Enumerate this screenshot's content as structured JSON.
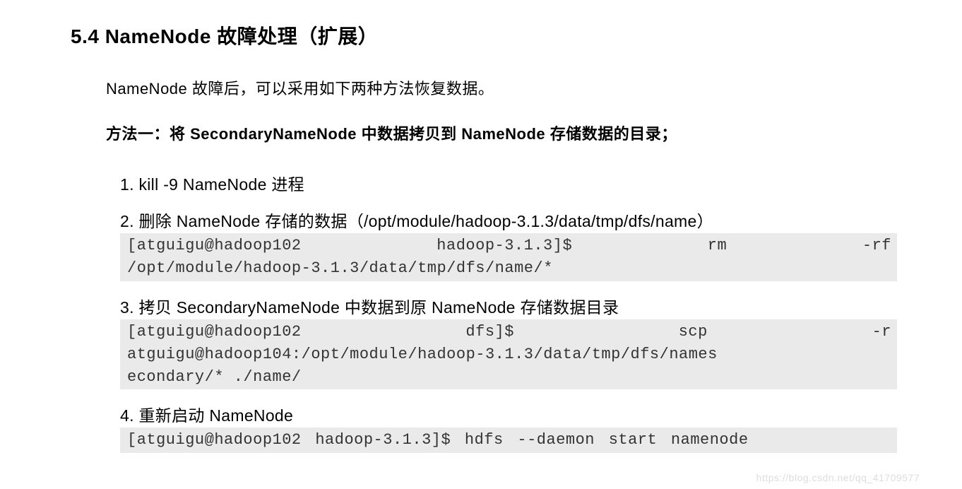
{
  "heading": "5.4 NameNode 故障处理（扩展）",
  "intro": "NameNode 故障后，可以采用如下两种方法恢复数据。",
  "method_title": "方法一：将 SecondaryNameNode 中数据拷贝到 NameNode 存储数据的目录；",
  "steps": {
    "s1": {
      "title": "1. kill -9 NameNode 进程"
    },
    "s2": {
      "title": "2.  删除 NameNode 存储的数据（/opt/module/hadoop-3.1.3/data/tmp/dfs/name）",
      "code_line1": "[atguigu@hadoop102 hadoop-3.1.3]$ rm -rf",
      "code_line2": "/opt/module/hadoop-3.1.3/data/tmp/dfs/name/*"
    },
    "s3": {
      "title": "3.  拷贝 SecondaryNameNode 中数据到原 NameNode 存储数据目录",
      "code_line1": "[atguigu@hadoop102 dfs]$ scp -r",
      "code_line2": "atguigu@hadoop104:/opt/module/hadoop-3.1.3/data/tmp/dfs/names",
      "code_line3": "econdary/* ./name/"
    },
    "s4": {
      "title": "4.  重新启动 NameNode",
      "code_line1": "[atguigu@hadoop102 hadoop-3.1.3]$ hdfs --daemon start namenode"
    }
  },
  "watermark": "https://blog.csdn.net/qq_41709577"
}
